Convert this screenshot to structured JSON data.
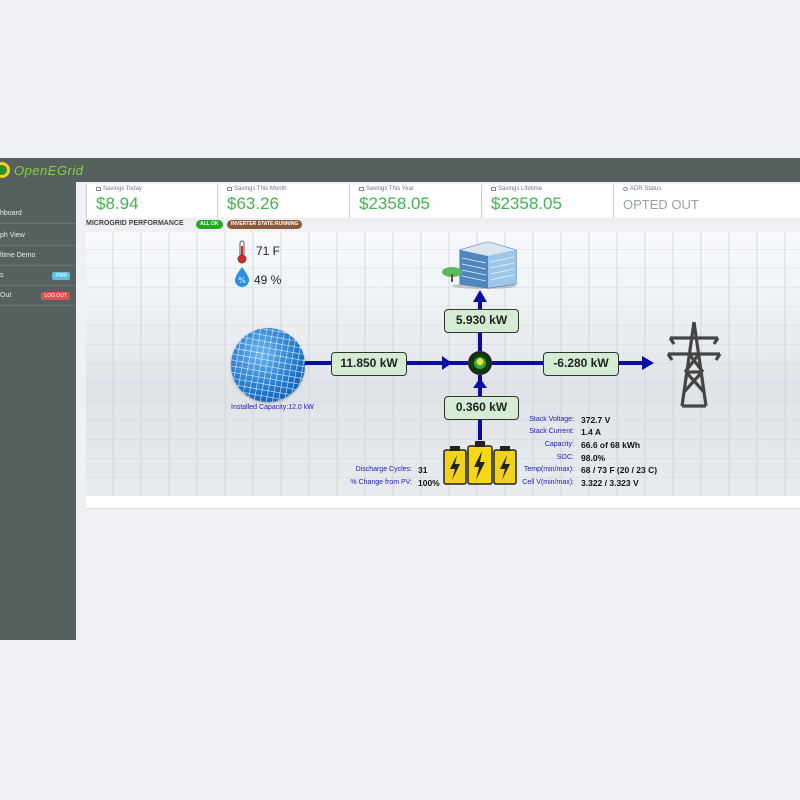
{
  "app": {
    "logo_text": "OpenEGrid"
  },
  "sidebar": {
    "items": [
      {
        "label": "hboard"
      },
      {
        "label": "ph View"
      },
      {
        "label": "ltime Demo"
      },
      {
        "label": "s",
        "badge": "PWR"
      },
      {
        "label": "Out",
        "badge": "LOG OUT"
      }
    ]
  },
  "stats": [
    {
      "title": "Savings Today",
      "value": "$8.94"
    },
    {
      "title": "Savings This Month",
      "value": "$63.26"
    },
    {
      "title": "Savings This Year",
      "value": "$2358.05"
    },
    {
      "title": "Savings Lifetime",
      "value": "$2358.05"
    },
    {
      "title": "ADR Status",
      "value": "OPTED OUT"
    }
  ],
  "performance": {
    "title": "MICROGRID PERFORMANCE",
    "status_ok": "ALL OK",
    "inverter_state": "INVERTER STATE:RUNNING"
  },
  "environment": {
    "temperature": "71 F",
    "humidity": "49 %"
  },
  "flows": {
    "solar": "11.850 kW",
    "building": "5.930 kW",
    "grid": "-6.280 kW",
    "battery": "0.360 kW"
  },
  "solar": {
    "installed_capacity": "Installed Capacity:12.0 kW"
  },
  "battery": {
    "left": [
      {
        "label": "Discharge Cycles:",
        "value": "31"
      },
      {
        "label": "% Change from PV:",
        "value": "100%"
      }
    ],
    "right": [
      {
        "label": "Stack Voltage:",
        "value": "372.7 V"
      },
      {
        "label": "Stack Current:",
        "value": "1.4 A"
      },
      {
        "label": "Capacity:",
        "value": "66.6 of 68 kWh"
      },
      {
        "label": "SOC:",
        "value": "98.0%"
      },
      {
        "label": "Temp(min/max):",
        "value": "68 / 73 F (20 / 23 C)"
      },
      {
        "label": "Cell V(min/max):",
        "value": "3.322 / 3.323 V"
      }
    ]
  },
  "colors": {
    "sidebar": "#55605f",
    "accent_green": "#3fb34f",
    "flow_line": "#0a0aa6",
    "ok_badge": "#22aa22",
    "state_badge": "#8a5a3a",
    "log_out_badge": "#d9534f",
    "pwr_badge": "#5bc0de"
  }
}
